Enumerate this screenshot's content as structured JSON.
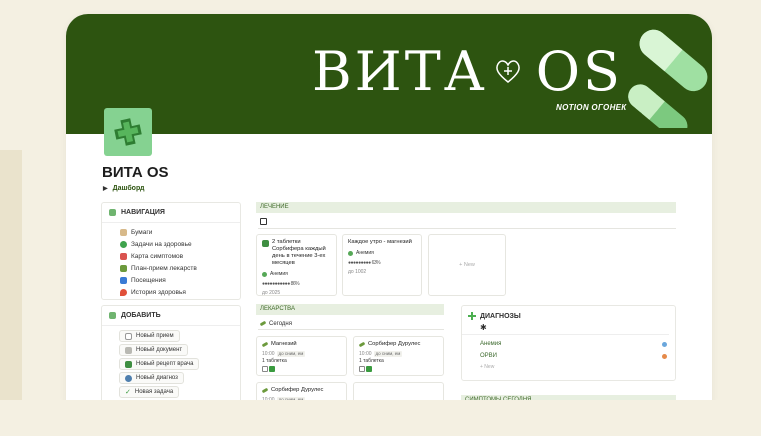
{
  "banner": {
    "brand_left": "ВИТА",
    "brand_right": "OS",
    "subtitle": "NOTION ОГОНЕК"
  },
  "page": {
    "title": "ВИТА OS",
    "toggle_label": "Дашборд"
  },
  "navigation": {
    "title": "НАВИГАЦИЯ",
    "items": [
      {
        "label": "Бумаги",
        "color": "#d7b98a"
      },
      {
        "label": "Задачи на здоровье",
        "color": "#3fa34d"
      },
      {
        "label": "Карта симптомов",
        "color": "#d9534f"
      },
      {
        "label": "План-прием лекарств",
        "color": "#6c9a3c"
      },
      {
        "label": "Посещения",
        "color": "#3a7bd5"
      },
      {
        "label": "История здоровья",
        "color": "#e0503a"
      }
    ]
  },
  "add": {
    "title": "ДОБАВИТЬ",
    "buttons": [
      "Новый прием",
      "Новый документ",
      "Новый рецепт врача",
      "Новый диагноз",
      "Новая задача"
    ]
  },
  "treatment": {
    "title": "ЛЕЧЕНИЕ",
    "cards": [
      {
        "title": "2 таблетки Сорбифера каждый день в течение 3-ех месяцев",
        "tag": "Анемия",
        "progress": "●●●●●●●●●●● 86%",
        "date": "до 2025"
      },
      {
        "title": "Каждое утро - магнезий",
        "tag": "Анемия",
        "progress": "●●●●●●●●● 63%",
        "date": "до 1002"
      }
    ],
    "new_label": "+ New"
  },
  "medicines": {
    "title": "ЛЕКАРСТВА",
    "tab": "Сегодня",
    "cards": [
      {
        "name": "Магнезий",
        "time": "10:00",
        "when": "до сним, ем",
        "dose": "1 таблетка"
      },
      {
        "name": "Сорбифер Дурулес",
        "time": "10:00",
        "when": "до сним, ем",
        "dose": "1 таблетка"
      },
      {
        "name": "Сорбифер Дурулес",
        "time": "10:00",
        "when": "до сним, ем",
        "dose": ""
      }
    ]
  },
  "diagnoses": {
    "title": "ДИАГНОЗЫ",
    "items": [
      {
        "label": "Анемия",
        "color": "#6ba7dc"
      },
      {
        "label": "ОРВИ",
        "color": "#e58a4a"
      }
    ],
    "new_label": "+ New"
  },
  "symptoms": {
    "title": "СИМПТОМЫ СЕГОДНЯ"
  }
}
